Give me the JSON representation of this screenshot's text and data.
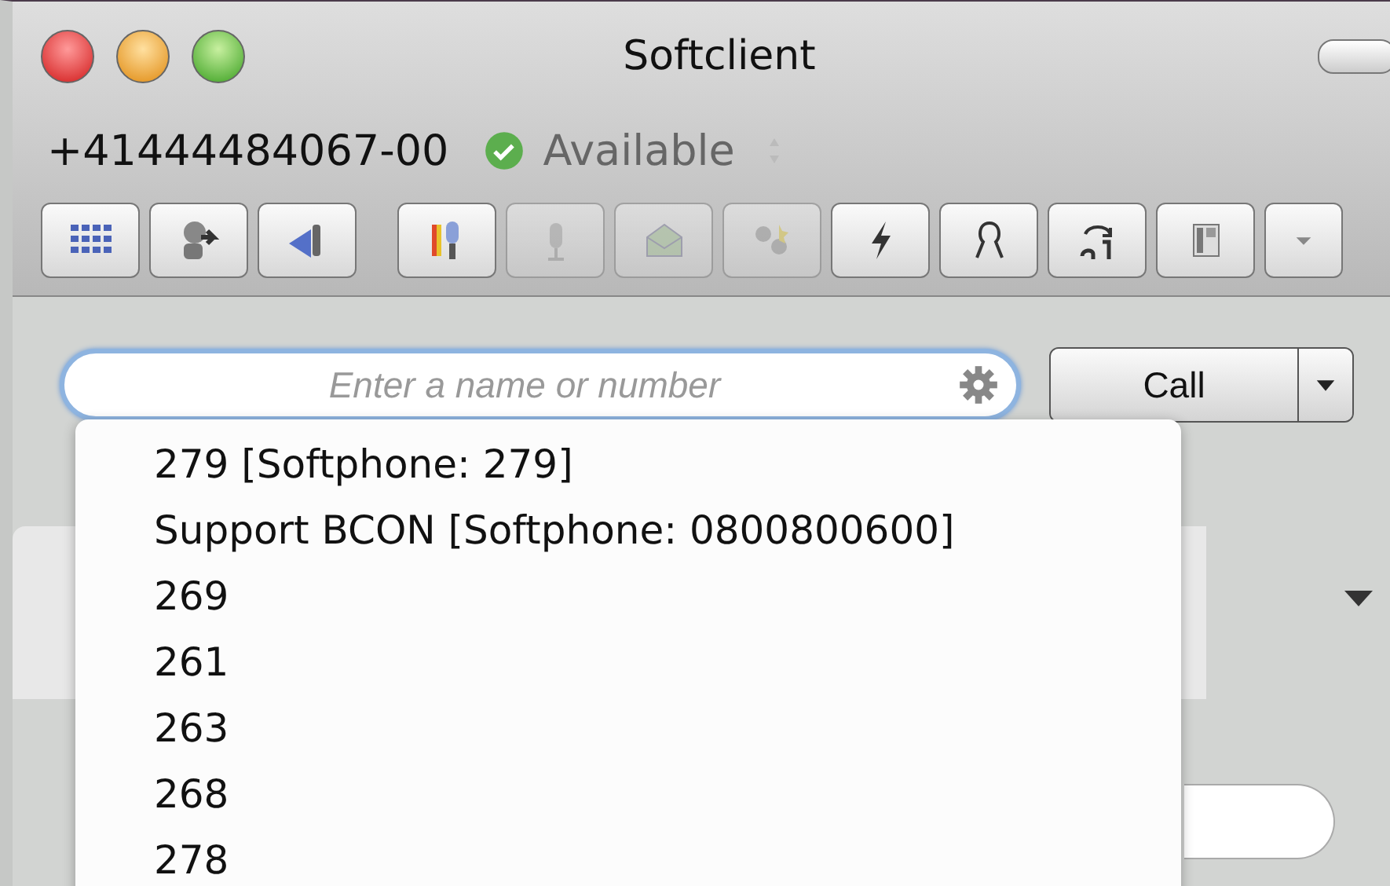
{
  "window": {
    "title": "Softclient"
  },
  "status": {
    "number": "+41444484067-00",
    "presence": "Available"
  },
  "toolbar": [
    {
      "kind": "dialpad",
      "disabled": false
    },
    {
      "kind": "transfer",
      "disabled": false
    },
    {
      "kind": "forward",
      "disabled": false
    },
    {
      "kind": "mic-color",
      "disabled": false
    },
    {
      "kind": "mic",
      "disabled": true
    },
    {
      "kind": "mail",
      "disabled": true
    },
    {
      "kind": "conference",
      "disabled": true
    },
    {
      "kind": "bolt",
      "disabled": false
    },
    {
      "kind": "person",
      "disabled": false
    },
    {
      "kind": "redial",
      "disabled": false
    },
    {
      "kind": "phone",
      "disabled": false
    },
    {
      "kind": "more",
      "disabled": false
    }
  ],
  "search": {
    "placeholder": "Enter a name or number"
  },
  "call_button": {
    "label": "Call"
  },
  "suggestions": [
    {
      "label": "279 [Softphone: 279]"
    },
    {
      "label": "Support BCON [Softphone: 0800800600]"
    },
    {
      "label": "269"
    },
    {
      "label": "261"
    },
    {
      "label": "263"
    },
    {
      "label": "268"
    },
    {
      "label": "278"
    }
  ]
}
